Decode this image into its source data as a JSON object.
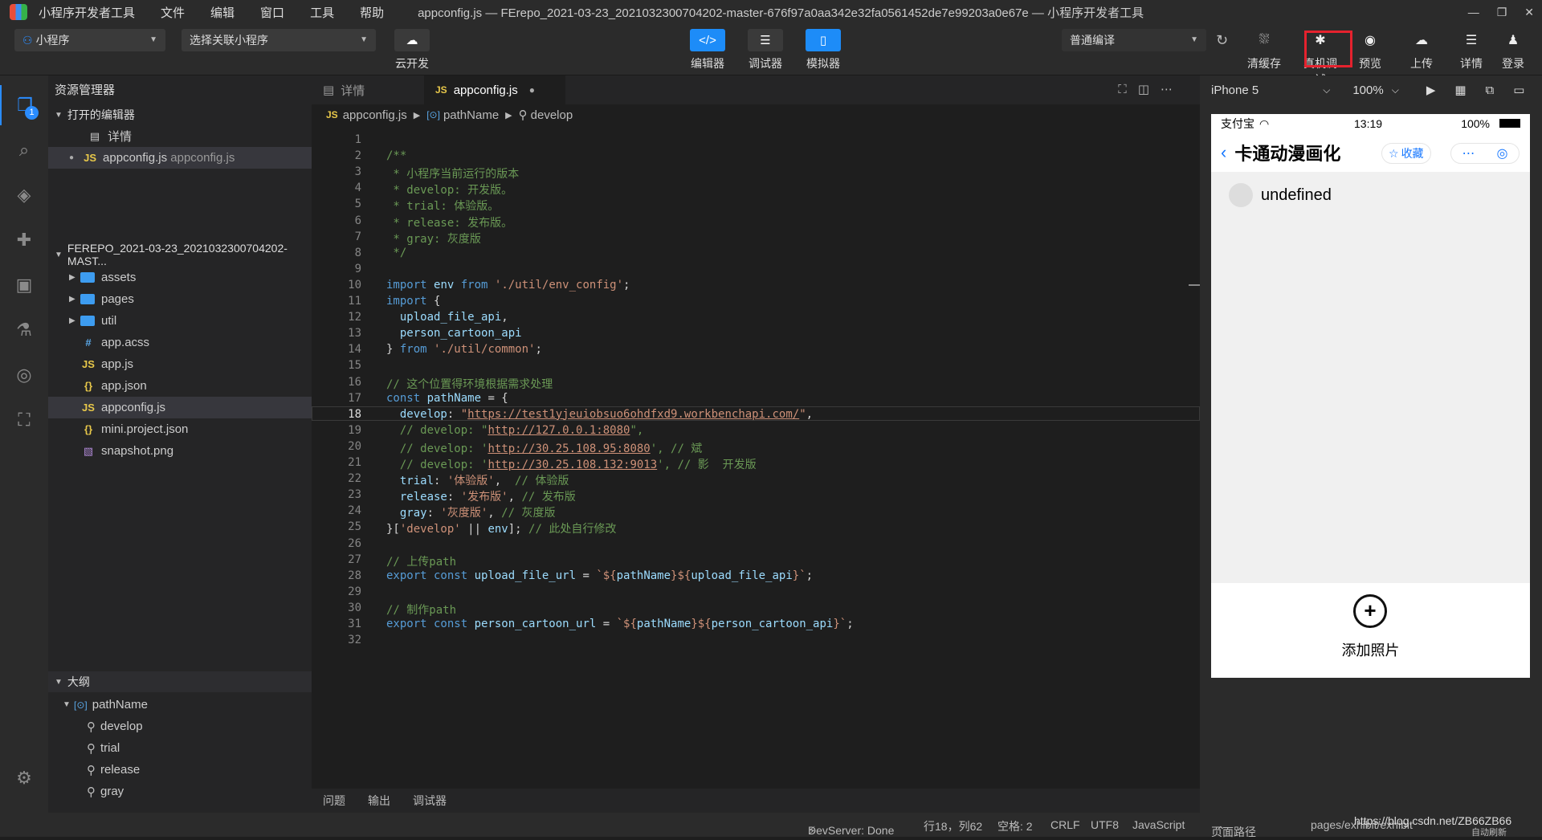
{
  "titlebar": {
    "menus": [
      "小程序开发者工具",
      "文件",
      "编辑",
      "窗口",
      "工具",
      "帮助"
    ],
    "title": "appconfig.js — FErepo_2021-03-23_2021032300704202-master-676f97a0aa342e32fa0561452de7e99203a0e67e — 小程序开发者工具",
    "controls": [
      "—",
      "❐",
      "✕"
    ]
  },
  "toolbar": {
    "mode_select": "小程序",
    "mode_icon": "⚇",
    "link_select": "选择关联小程序",
    "cloud_label": "云开发",
    "editor_label": "编辑器",
    "debugger_label": "调试器",
    "simulator_label": "模拟器",
    "compile_select": "普通编译",
    "right": [
      {
        "label": "清缓存",
        "icon": "⛆"
      },
      {
        "label": "真机调试",
        "icon": "✱"
      },
      {
        "label": "预览",
        "icon": "◉"
      },
      {
        "label": "上传",
        "icon": "☁"
      },
      {
        "label": "详情",
        "icon": "☰"
      },
      {
        "label": "登录",
        "icon": "♟"
      }
    ],
    "refresh_icon": "↻"
  },
  "activity": {
    "badge": "1"
  },
  "explorer": {
    "header": "资源管理器",
    "open_editors_title": "打开的编辑器",
    "open_editors": [
      {
        "name": "详情",
        "type": "doc",
        "icon": "▤"
      },
      {
        "name": "appconfig.js",
        "path": "appconfig.js",
        "type": "js",
        "icon": "JS"
      }
    ],
    "project_title": "FEREPO_2021-03-23_2021032300704202-MAST...",
    "tree": [
      {
        "name": "assets",
        "kind": "folder"
      },
      {
        "name": "pages",
        "kind": "folder"
      },
      {
        "name": "util",
        "kind": "folder"
      },
      {
        "name": "app.acss",
        "kind": "css",
        "icon": "#"
      },
      {
        "name": "app.js",
        "kind": "js",
        "icon": "JS"
      },
      {
        "name": "app.json",
        "kind": "json",
        "icon": "{}"
      },
      {
        "name": "appconfig.js",
        "kind": "js",
        "icon": "JS"
      },
      {
        "name": "mini.project.json",
        "kind": "json",
        "icon": "{}"
      },
      {
        "name": "snapshot.png",
        "kind": "png",
        "icon": "▧"
      }
    ],
    "outline_title": "大纲",
    "outline_root": "pathName",
    "outline_items": [
      "develop",
      "trial",
      "release",
      "gray"
    ]
  },
  "editor": {
    "tabs": [
      {
        "label": "详情",
        "icon": "▤"
      },
      {
        "label": "appconfig.js",
        "icon": "JS"
      }
    ],
    "breadcrumb": [
      "appconfig.js",
      "pathName",
      "develop"
    ],
    "current_line": 18,
    "lines": [
      [],
      [
        [
          "c-com",
          "/**"
        ]
      ],
      [
        [
          "c-com",
          " * 小程序当前运行的版本"
        ]
      ],
      [
        [
          "c-com",
          " * develop: 开发版。"
        ]
      ],
      [
        [
          "c-com",
          " * trial: 体验版。"
        ]
      ],
      [
        [
          "c-com",
          " * release: 发布版。"
        ]
      ],
      [
        [
          "c-com",
          " * gray: 灰度版"
        ]
      ],
      [
        [
          "c-com",
          " */"
        ]
      ],
      [],
      [
        [
          "c-kw",
          "import "
        ],
        [
          "c-id",
          "env "
        ],
        [
          "c-kw",
          "from "
        ],
        [
          "c-str",
          "'./util/env_config'"
        ],
        [
          "",
          "; "
        ]
      ],
      [
        [
          "c-kw",
          "import "
        ],
        [
          "",
          "{"
        ]
      ],
      [
        [
          "",
          "  "
        ],
        [
          "c-id",
          "upload_file_api"
        ],
        [
          "",
          ","
        ]
      ],
      [
        [
          "",
          "  "
        ],
        [
          "c-id",
          "person_cartoon_api"
        ]
      ],
      [
        [
          "",
          "} "
        ],
        [
          "c-kw",
          "from "
        ],
        [
          "c-str",
          "'./util/common'"
        ],
        [
          "",
          ";"
        ]
      ],
      [],
      [
        [
          "c-com",
          "// 这个位置得环境根据需求处理"
        ]
      ],
      [
        [
          "c-kw",
          "const "
        ],
        [
          "c-id",
          "pathName"
        ],
        [
          "",
          " = {"
        ]
      ],
      [
        [
          "",
          "  "
        ],
        [
          "c-id",
          "develop"
        ],
        [
          "",
          ": "
        ],
        [
          "c-str",
          "\""
        ],
        [
          "c-url",
          "https://test1yjeuiobsuo6ohdfxd9.workbenchapi.com/"
        ],
        [
          "c-str",
          "\""
        ],
        [
          "",
          ","
        ]
      ],
      [
        [
          "",
          "  "
        ],
        [
          "c-com",
          "// develop: \""
        ],
        [
          "c-url",
          "http://127.0.0.1:8080"
        ],
        [
          "c-com",
          "\","
        ]
      ],
      [
        [
          "",
          "  "
        ],
        [
          "c-com",
          "// develop: '"
        ],
        [
          "c-url",
          "http://30.25.108.95:8080"
        ],
        [
          "c-com",
          "', // 斌"
        ]
      ],
      [
        [
          "",
          "  "
        ],
        [
          "c-com",
          "// develop: '"
        ],
        [
          "c-url",
          "http://30.25.108.132:9013"
        ],
        [
          "c-com",
          "', // 影  开发版"
        ]
      ],
      [
        [
          "",
          "  "
        ],
        [
          "c-id",
          "trial"
        ],
        [
          "",
          ": "
        ],
        [
          "c-str",
          "'体验版'"
        ],
        [
          "",
          ",  "
        ],
        [
          "c-com",
          "// 体验版"
        ]
      ],
      [
        [
          "",
          "  "
        ],
        [
          "c-id",
          "release"
        ],
        [
          "",
          ": "
        ],
        [
          "c-str",
          "'发布版'"
        ],
        [
          "",
          ", "
        ],
        [
          "c-com",
          "// 发布版"
        ]
      ],
      [
        [
          "",
          "  "
        ],
        [
          "c-id",
          "gray"
        ],
        [
          "",
          ": "
        ],
        [
          "c-str",
          "'灰度版'"
        ],
        [
          "",
          ", "
        ],
        [
          "c-com",
          "// 灰度版"
        ]
      ],
      [
        [
          "",
          "}["
        ],
        [
          "c-str",
          "'develop'"
        ],
        [
          "",
          " || "
        ],
        [
          "c-id",
          "env"
        ],
        [
          "",
          "]; "
        ],
        [
          "c-com",
          "// 此处自行修改"
        ]
      ],
      [],
      [
        [
          "c-com",
          "// 上传path"
        ]
      ],
      [
        [
          "c-kw",
          "export const "
        ],
        [
          "c-id",
          "upload_file_url"
        ],
        [
          "",
          " = "
        ],
        [
          "c-str",
          "`${"
        ],
        [
          "c-id",
          "pathName"
        ],
        [
          "c-str",
          "}${"
        ],
        [
          "c-id",
          "upload_file_api"
        ],
        [
          "c-str",
          "}`"
        ],
        [
          "",
          ";"
        ]
      ],
      [],
      [
        [
          "c-com",
          "// 制作path"
        ]
      ],
      [
        [
          "c-kw",
          "export const "
        ],
        [
          "c-id",
          "person_cartoon_url"
        ],
        [
          "",
          " = "
        ],
        [
          "c-str",
          "`${"
        ],
        [
          "c-id",
          "pathName"
        ],
        [
          "c-str",
          "}${"
        ],
        [
          "c-id",
          "person_cartoon_api"
        ],
        [
          "c-str",
          "}`"
        ],
        [
          "",
          ";"
        ]
      ],
      []
    ]
  },
  "panel": {
    "tabs": [
      "问题",
      "输出",
      "调试器"
    ]
  },
  "simulator": {
    "device": "iPhone 5",
    "zoom": "100%",
    "carrier": "支付宝",
    "time": "13:19",
    "battery": "100%",
    "nav_title": "卡通动漫画化",
    "favorite": "收藏",
    "list_text": "undefined",
    "add_label": "添加照片"
  },
  "statusbar": {
    "devserver": "DevServer: Done",
    "position": "行18，列62",
    "spaces": "空格: 2",
    "eol": "CRLF",
    "encoding": "UTF8",
    "language": "JavaScript",
    "page_path_label": "页面路径",
    "page_path": "pages/exhibit/exhibit",
    "watermark": "https://blog.csdn.net/ZB66ZB66",
    "autosave": "自动刷新"
  }
}
